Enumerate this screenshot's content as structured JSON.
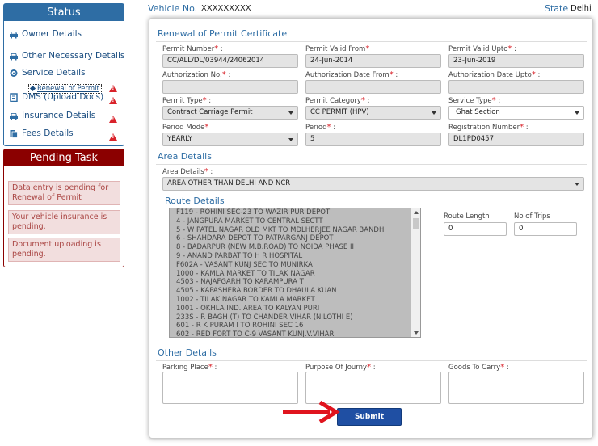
{
  "topbar": {
    "vehicle_label": "Vehicle No.",
    "vehicle_value": "XXXXXXXXX",
    "state_label": "State",
    "state_value": "Delhi"
  },
  "status": {
    "title": "Status",
    "items": [
      {
        "label": "Owner Details",
        "icon": "car-icon"
      },
      {
        "label": "Other Necessary Details",
        "icon": "car-icon"
      },
      {
        "label": "Service Details",
        "icon": "gear-icon"
      },
      {
        "label": "DMS (Upload Docs)",
        "icon": "file-icon",
        "warning": true
      },
      {
        "label": "Insurance Details",
        "icon": "car-icon",
        "warning": true
      },
      {
        "label": "Fees Details",
        "icon": "document-icon",
        "warning": true
      }
    ],
    "sub_item": {
      "label": "Renewal of Permit",
      "warning": true
    }
  },
  "pending": {
    "title": "Pending Task",
    "items": [
      "Data entry is pending for Renewal of Permit",
      "Your vehicle insurance is pending.",
      "Document uploading is pending."
    ]
  },
  "form": {
    "section_title": "Renewal of Permit Certificate",
    "permit_number": {
      "label": "Permit Number",
      "value": "CC/ALL/DL/03944/24062014"
    },
    "permit_valid_from": {
      "label": "Permit Valid From",
      "value": "24-Jun-2014"
    },
    "permit_valid_upto": {
      "label": "Permit Valid Upto",
      "value": "23-Jun-2019"
    },
    "authorization_no": {
      "label": "Authorization No.",
      "value": ""
    },
    "authorization_date_from": {
      "label": "Authorization Date From",
      "value": ""
    },
    "authorization_date_upto": {
      "label": "Authorization Date Upto",
      "value": ""
    },
    "permit_type": {
      "label": "Permit Type",
      "value": "Contract Carriage Permit"
    },
    "permit_category": {
      "label": "Permit Category",
      "value": "CC PERMIT (HPV)"
    },
    "service_type": {
      "label": "Service Type",
      "value": "Ghat Section"
    },
    "period_mode": {
      "label": "Period Mode",
      "value": "YEARLY"
    },
    "period": {
      "label": "Period",
      "value": "5"
    },
    "registration_number": {
      "label": "Registration Number",
      "value": "DL1PD0457"
    }
  },
  "area": {
    "section_title": "Area Details",
    "area_details": {
      "label": "Area Details",
      "value": "AREA OTHER THAN DELHI AND NCR"
    }
  },
  "route": {
    "section_title": "Route Details",
    "items": [
      "F119 - ROHINI SEC-23 TO WAZIR PUR DEPOT",
      "4 - JANGPURA MARKET TO CENTRAL SECTT",
      "5 - W PATEL NAGAR OLD MKT TO MDLHERJEE NAGAR BANDH",
      "6 - SHAHDARA DEPOT TO PATPARGANJ DEPOT",
      "8 - BADARPUR (NEW M.B.ROAD) TO NOIDA PHASE II",
      "9 - ANAND PARBAT TO H R HOSPITAL",
      "F602A - VASANT KUNJ SEC TO MUNIRKA",
      "1000 - KAMLA MARKET TO TILAK NAGAR",
      "4503 - NAJAFGARH TO KARAMPURA T",
      "4505 - KAPASHERA BORDER TO DHAULA KUAN",
      "1002 - TILAK NAGAR TO KAMLA MARKET",
      "1001 - OKHLA IND. AREA TO KALYAN PURI",
      "233S - P. BAGH (T) TO CHANDER VIHAR (NILOTHI E)",
      "601 - R K PURAM I TO ROHINI SEC 16",
      "602 - RED FORT TO C-9 VASANT KUNJ.V.VIHAR"
    ],
    "route_length": {
      "label": "Route Length",
      "value": "0"
    },
    "no_of_trips": {
      "label": "No of Trips",
      "value": "0"
    }
  },
  "other": {
    "section_title": "Other Details",
    "parking_place": {
      "label": "Parking Place"
    },
    "purpose_of_journey": {
      "label": "Purpose Of Journy"
    },
    "goods_to_carry": {
      "label": "Goods To Carry"
    }
  },
  "submit_label": "Submit",
  "colors": {
    "primary": "#2e6da4",
    "danger": "#8b0000",
    "required": "#d9222a",
    "button": "#1f4fa3",
    "arrow": "#e0141e"
  }
}
